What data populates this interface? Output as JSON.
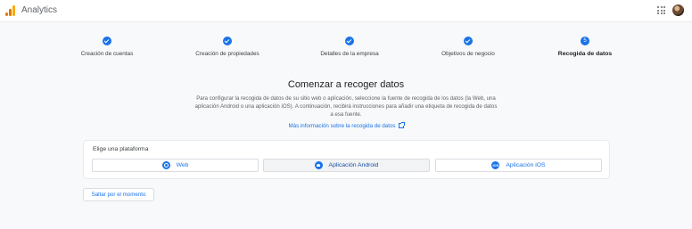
{
  "header": {
    "app_title": "Analytics",
    "logo_icon": "analytics-logo-icon",
    "apps_icon": "apps-grid-icon",
    "avatar_icon": "user-avatar"
  },
  "stepper": {
    "steps": [
      {
        "label": "Creación de cuentas",
        "status": "complete"
      },
      {
        "label": "Creación de propiedades",
        "status": "complete"
      },
      {
        "label": "Detalles de la empresa",
        "status": "complete"
      },
      {
        "label": "Objetivos de negocio",
        "status": "complete"
      },
      {
        "label": "Recogida de datos",
        "status": "active",
        "number": "5"
      }
    ]
  },
  "main": {
    "heading": "Comenzar a recoger datos",
    "description": "Para configurar la recogida de datos de su sitio web o aplicación, seleccione la fuente de recogida de los datos (la Web, una aplicación Android o una aplicación iOS). A continuación, recibirá instrucciones para añadir una etiqueta de recogida de datos a esa fuente.",
    "more_info_link": "Más información sobre la recogida de datos"
  },
  "platform_card": {
    "title": "Elige una plataforma",
    "options": [
      {
        "label": "Web",
        "icon": "web-globe-icon"
      },
      {
        "label": "Aplicación Android",
        "icon": "android-icon",
        "selected": true
      },
      {
        "label": "Aplicación iOS",
        "icon": "ios-icon",
        "badge": "iOS"
      }
    ]
  },
  "skip_button": "Saltar por el momento",
  "colors": {
    "accent": "#1a73e8",
    "logo_orange": "#e37400",
    "logo_yellow": "#f9ab00"
  }
}
